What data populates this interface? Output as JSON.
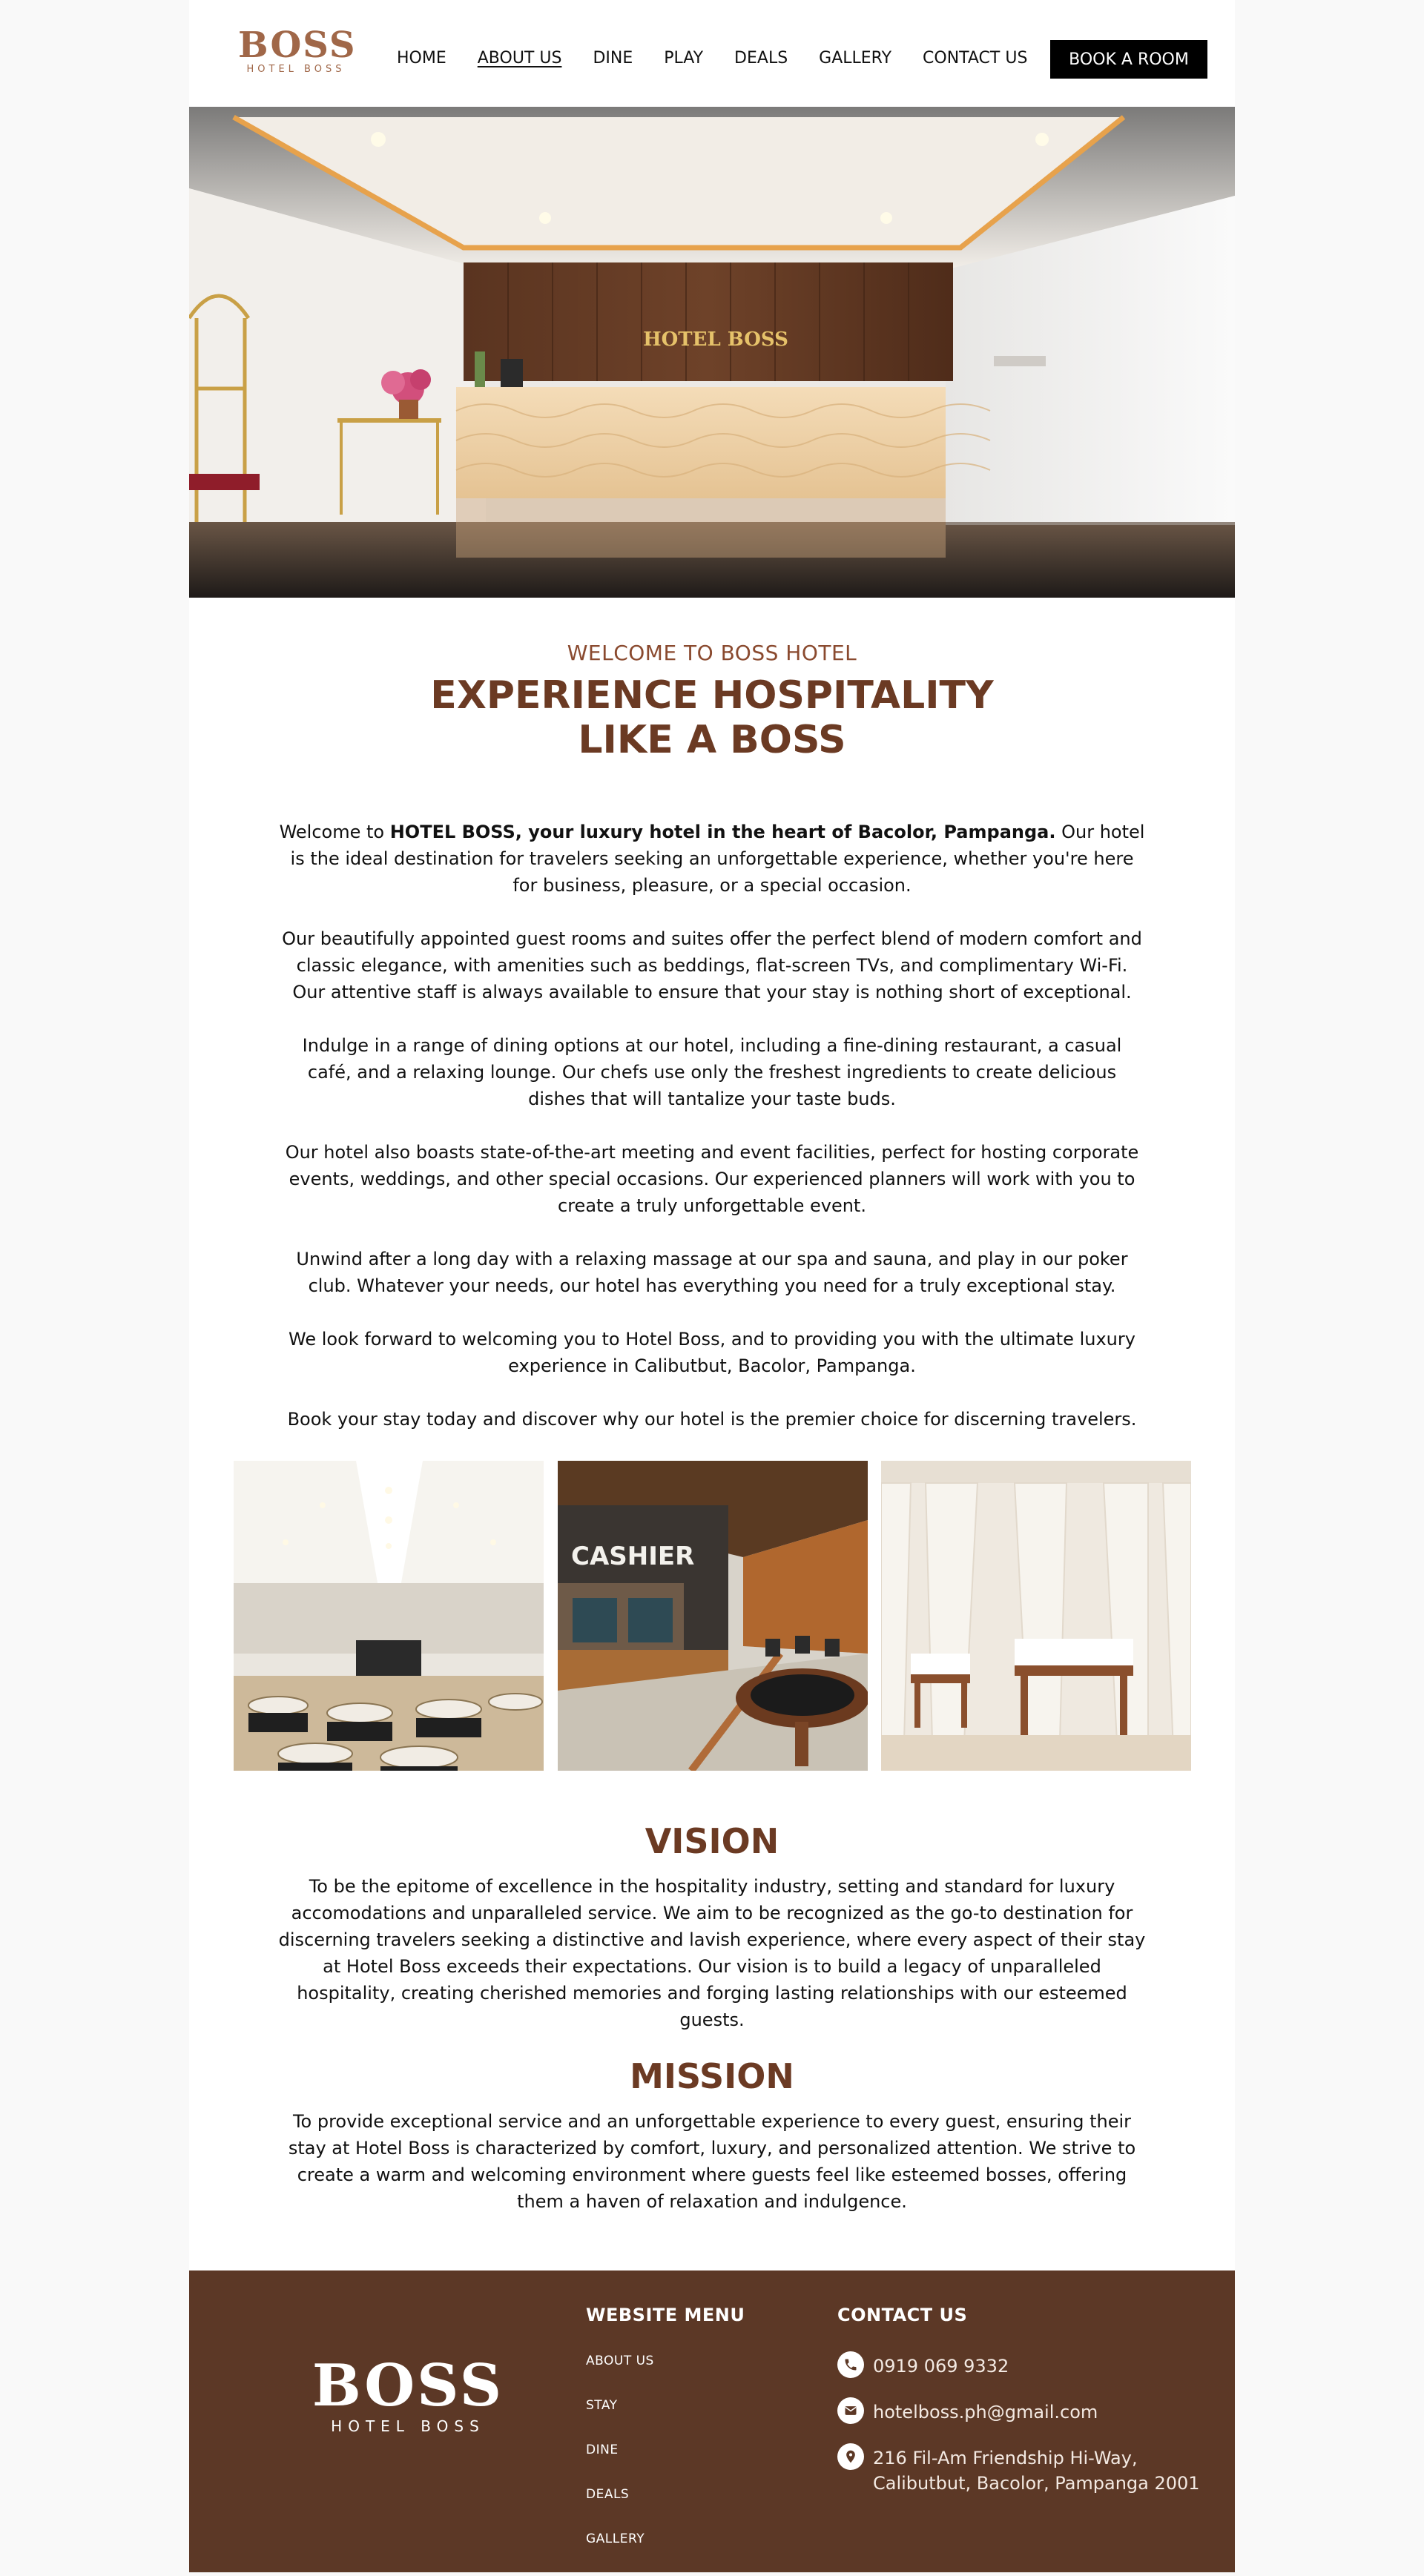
{
  "header": {
    "logo_mark": "BOSS",
    "logo_sub": "HOTEL BOSS",
    "nav": [
      "HOME",
      "ABOUT US",
      "DINE",
      "PLAY",
      "DEALS",
      "GALLERY",
      "CONTACT US"
    ],
    "active_nav": "ABOUT US",
    "book_button": "BOOK A ROOM"
  },
  "hero": {
    "image": "hotel lobby reception desk",
    "sign_text": "HOTEL BOSS",
    "wall_text": "HOTEL BOSS"
  },
  "intro": {
    "eyebrow": "WELCOME TO BOSS HOTEL",
    "headline_line1": "EXPERIENCE HOSPITALITY",
    "headline_line2": "LIKE A BOSS",
    "p1_lead": "Welcome to ",
    "p1_bold": "HOTEL BOSS, your luxury hotel in the heart of Bacolor, Pampanga.",
    "p1_rest": " Our hotel is the ideal destination for travelers seeking an unforgettable experience, whether you're here for business, pleasure, or a special occasion.",
    "p2": "Our beautifully appointed guest rooms and suites offer the perfect blend of modern comfort and classic elegance, with amenities such as beddings, flat-screen TVs, and complimentary Wi-Fi. Our attentive staff is always available to ensure that your stay is nothing short of exceptional.",
    "p3": "Indulge in a range of dining options at our hotel, including a fine-dining restaurant, a casual café, and a relaxing lounge. Our chefs use only the freshest ingredients to create delicious dishes that will tantalize your taste buds.",
    "p4": "Our hotel also boasts state-of-the-art meeting and event facilities, perfect for hosting corporate events, weddings, and other special occasions. Our experienced planners will work with you to create a truly unforgettable event.",
    "p5": "Unwind after a long day with a relaxing massage at our spa and sauna, and play in our poker club. Whatever your needs, our hotel has everything you need for a truly exceptional stay.",
    "p6": "We look forward to welcoming you to Hotel Boss, and to providing you with the ultimate luxury experience in Calibutbut, Bacolor, Pampanga.",
    "p7": "Book your stay today and discover why our hotel is the premier choice for discerning travelers."
  },
  "gallery": {
    "images": [
      "banquet hall",
      "casino cashier and poker tables",
      "spa massage room"
    ],
    "cashier_sign": "CASHIER"
  },
  "vision": {
    "title": "VISION",
    "body": "To be the epitome of excellence in the hospitality industry, setting and standard for luxury accomodations and unparalleled service. We aim to be recognized as the go-to destination for discerning travelers seeking a distinctive and lavish experience, where every aspect of their stay at Hotel Boss exceeds their expectations. Our vision is to build a legacy of unparalleled hospitality, creating cherished memories and forging lasting relationships with our esteemed guests."
  },
  "mission": {
    "title": "MISSION",
    "body": "To provide exceptional service and an unforgettable experience to every guest, ensuring their stay at Hotel Boss is characterized by comfort, luxury, and personalized attention. We strive to create a warm and welcoming environment where guests feel like esteemed bosses, offering them a haven of relaxation and indulgence."
  },
  "footer": {
    "logo_mark": "BOSS",
    "logo_sub": "HOTEL BOSS",
    "menu_title": "WEBSITE MENU",
    "menu": [
      "ABOUT US",
      "STAY",
      "DINE",
      "DEALS",
      "GALLERY"
    ],
    "contact_title": "CONTACT US",
    "phone": "0919 069 9332",
    "email": "hotelboss.ph@gmail.com",
    "address_line1": "216 Fil-Am Friendship Hi-Way,",
    "address_line2": "Calibutbut, Bacolor, Pampanga 2001",
    "icons": [
      "phone-icon",
      "mail-icon",
      "location-pin-icon"
    ]
  },
  "colors": {
    "brand_brown": "#6b3a23",
    "eyebrow": "#8a4a2f",
    "logo_copper": "#a06748",
    "footer_bg": "#5c3826",
    "book_button_bg": "#000000"
  }
}
